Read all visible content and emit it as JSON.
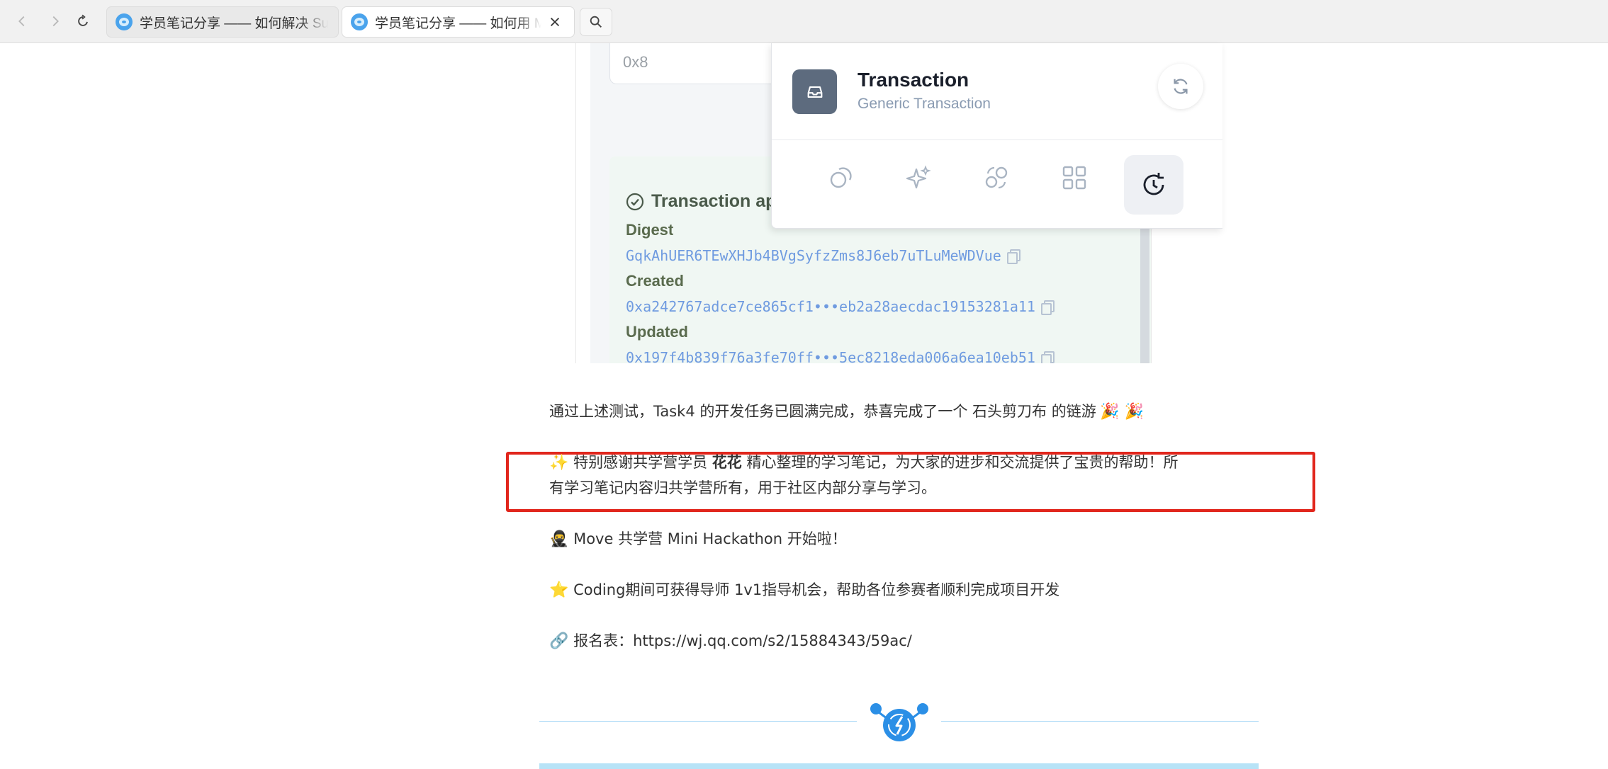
{
  "browser": {
    "tabs": [
      {
        "title": "学员笔记分享 —— 如何解决 Sui 钱包",
        "active": false
      },
      {
        "title": "学员笔记分享 —— 如何用 Move 开发",
        "active": true
      }
    ]
  },
  "screenshot": {
    "input_value": "0x8",
    "result_title": "Transaction ap",
    "digest_label": "Digest",
    "digest_value": "GqkAhUER6TEwXHJb4BVgSyfzZms8J6eb7uTLuMeWDVue",
    "created_label": "Created",
    "created_value": "0xa242767adce7ce865cf1•••eb2a28aecdac19153281a11",
    "updated_label": "Updated",
    "updated_value": "0x197f4b839f76a3fe70ff•••5ec8218eda006a6ea10eb51"
  },
  "wallet": {
    "title": "Transaction",
    "subtitle": "Generic Transaction"
  },
  "article": {
    "p1": "通过上述测试，Task4 的开发任务已圆满完成，恭喜完成了一个 石头剪刀布 的链游",
    "p1_emoji": "🎉 🎉",
    "p2_emoji": "✨",
    "p2_pre": " 特别感谢共学营学员 ",
    "p2_name": "花花",
    "p2_post": " 精心整理的学习笔记，为大家的进步和交流提供了宝贵的帮助！所",
    "p2_line2": "有学习笔记内容归共学营所有，用于社区内部分享与学习。",
    "p3_emoji": "🥷",
    "p3": " Move 共学营 Mini Hackathon 开始啦！",
    "p4_emoji": "⭐",
    "p4": " Coding期间可获得导师 1v1指导机会，帮助各位参赛者顺利完成项目开发",
    "p5_emoji": "🔗",
    "p5": "  报名表：https://wj.qq.com/s2/15884343/59ac/"
  },
  "colors": {
    "highlight": "#e1261c",
    "link_blue": "#6f9be0",
    "accent": "#2b8fe6"
  }
}
